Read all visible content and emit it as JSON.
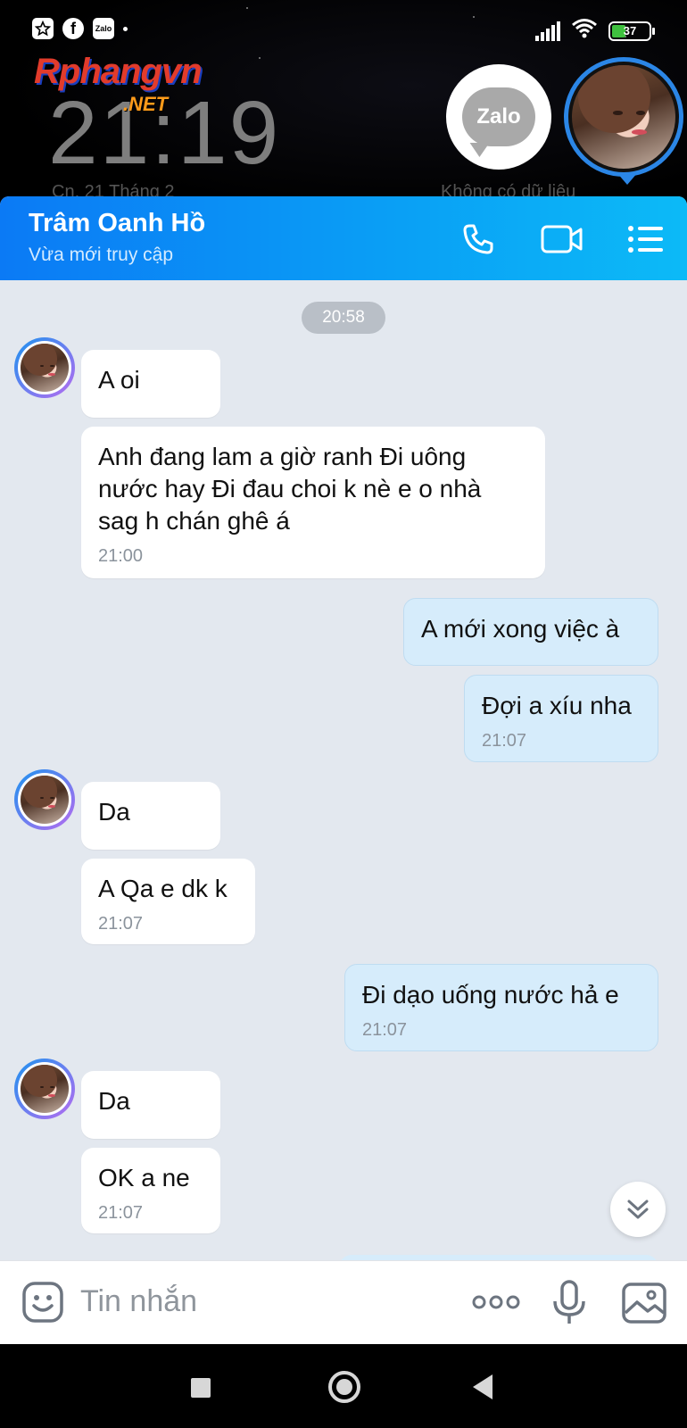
{
  "status_bar": {
    "battery": "37",
    "left_icons": [
      "star-app-icon",
      "facebook-icon",
      "zalo-status-icon"
    ],
    "zalo_small_label": "Zalo"
  },
  "lockscreen": {
    "watermark_logo": "Rphangvn",
    "watermark_suffix": ".NET",
    "clock": "21:19",
    "date_ghost": "Cn, 21 Tháng 2",
    "nodata_ghost": "Không có dữ liệu",
    "zalo_label": "Zalo"
  },
  "chat_header": {
    "contact_name": "Trâm Oanh Hồ",
    "status": "Vừa mới truy cập",
    "actions": [
      "phone-icon",
      "video-call-icon",
      "menu-list-icon"
    ]
  },
  "time_divider": "20:58",
  "messages": [
    {
      "dir": "in",
      "text": "A oi",
      "time": ""
    },
    {
      "dir": "in",
      "text": "Anh đang lam a giờ  ranh Đi uông nước  hay Đi đau choi k nè e o nhà sag h chán ghê á",
      "time": "21:00"
    },
    {
      "dir": "out",
      "text": "A mới xong việc à",
      "time": ""
    },
    {
      "dir": "out",
      "text": "Đợi a xíu nha",
      "time": "21:07"
    },
    {
      "dir": "in",
      "text": "Da",
      "time": ""
    },
    {
      "dir": "in",
      "text": "A Qa e dk k",
      "time": "21:07"
    },
    {
      "dir": "out",
      "text": "Đi dạo uống nước hả e",
      "time": "21:07"
    },
    {
      "dir": "in",
      "text": "Da",
      "time": ""
    },
    {
      "dir": "in",
      "text": "OK a ne",
      "time": "21:07"
    }
  ],
  "composer": {
    "placeholder": "Tin nhắn"
  },
  "colors": {
    "header_start": "#0b7af5",
    "header_end": "#0cbaf7",
    "chat_bg": "#e3e8ef",
    "outgoing_bubble": "#d6ecfb",
    "incoming_bubble": "#ffffff"
  }
}
